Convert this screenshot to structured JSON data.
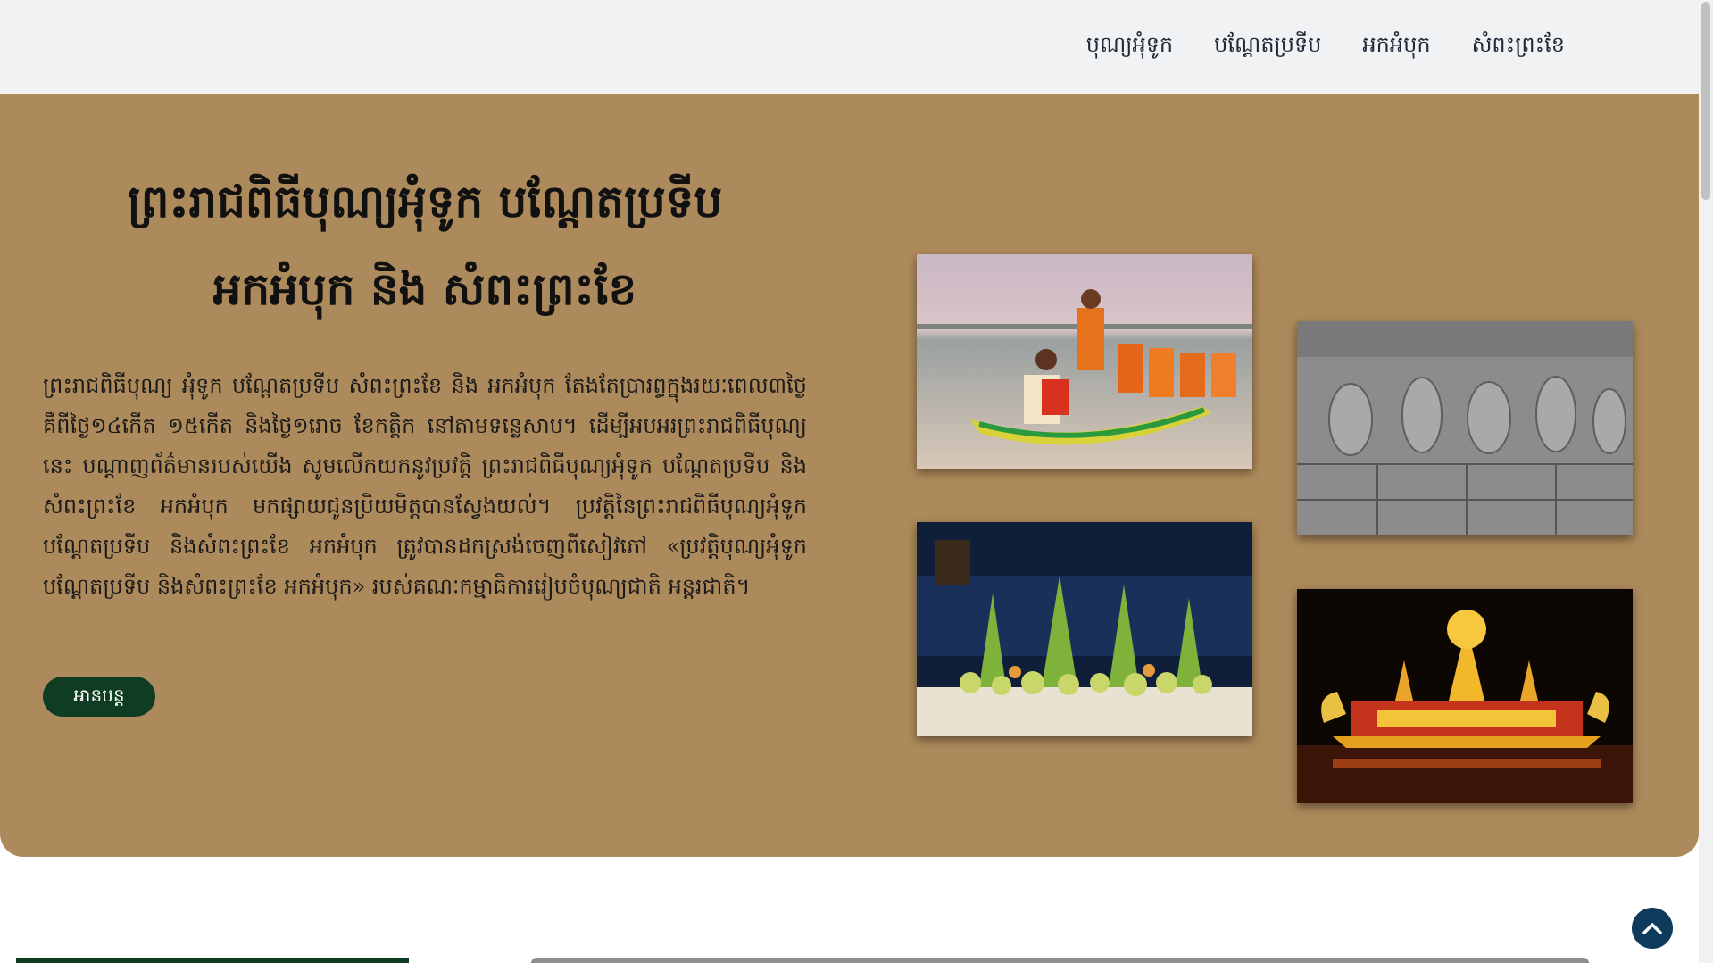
{
  "nav": {
    "items": [
      {
        "label": "បុណ្យអុំទូក"
      },
      {
        "label": "បណ្ដែតប្រទីប"
      },
      {
        "label": "អកអំបុក"
      },
      {
        "label": "សំពះព្រះខែ"
      }
    ]
  },
  "hero": {
    "title_line1": "ព្រះរាជពិធីបុណ្យអុំទូក បណ្ដែតប្រទីប",
    "title_line2": "អកអំបុក និង សំពះព្រះខែ",
    "body": "ព្រះរាជពិធីបុណ្យ អុំទូក បណ្ដែតប្រទីប សំពះព្រះខែ និង អកអំបុក តែងតែប្រារព្ធក្នុងរយៈពេល៣ថ្ងៃ គឺពីថ្ងៃ១៤កើត ១៥កើត និងថ្ងៃ១រោច ខែកត្តិក នៅតាមទន្លេសាប។ ដើម្បីអបអរព្រះរាជពិធីបុណ្យនេះ បណ្ដាញព័ត៌មានរបស់យើង សូមលើកយកនូវប្រវត្តិ ព្រះរាជពិធីបុណ្យអុំទូក បណ្ដែតប្រទីប និងសំពះព្រះខែ អកអំបុក មកផ្សាយជូនប្រិយមិត្តបានស្វែងយល់។ ប្រវត្តិនៃព្រះរាជពិធីបុណ្យអុំទូក បណ្ដែតប្រទីប និងសំពះព្រះខែ អកអំបុក ត្រូវបានដកស្រង់ចេញពីសៀវភៅ «ប្រវត្តិបុណ្យអុំទូក បណ្ដែតប្រទីប និងសំពះព្រះខែ អកអំបុក» របស់គណៈកម្មាធិការរៀបចំបុណ្យជាតិ អន្តរជាតិ។",
    "read_more": "អានបន្ត"
  },
  "gallery": {
    "images": [
      {
        "icon": "boat-race-photo"
      },
      {
        "icon": "stone-relief-photo"
      },
      {
        "icon": "offerings-table-photo"
      },
      {
        "icon": "illuminated-float-photo"
      }
    ]
  },
  "colors": {
    "nav_bg": "#f1f2f3",
    "hero_bg": "#ad8a5b",
    "button_bg": "#0f3d24",
    "back_to_top_bg": "#0e3a5c"
  }
}
